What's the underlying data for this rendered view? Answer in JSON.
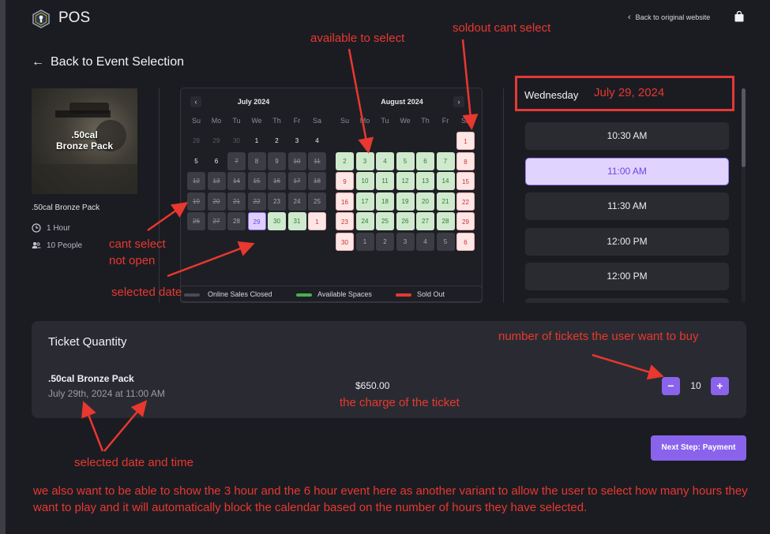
{
  "header": {
    "brand": "POS",
    "back_to_website": "Back to original website"
  },
  "nav": {
    "back_to_event": "Back to Event Selection"
  },
  "product": {
    "image_label": ".50cal\nBronze Pack",
    "name": ".50cal Bronze Pack",
    "duration": "1 Hour",
    "people": "10 People"
  },
  "calendar": {
    "weekdays": [
      "Su",
      "Mo",
      "Tu",
      "We",
      "Th",
      "Fr",
      "Sa"
    ],
    "months": [
      {
        "title": "July 2024",
        "days": [
          {
            "d": "28",
            "s": "faint"
          },
          {
            "d": "29",
            "s": "faint"
          },
          {
            "d": "30",
            "s": "faint"
          },
          {
            "d": "1",
            "s": "plain"
          },
          {
            "d": "2",
            "s": "plain"
          },
          {
            "d": "3",
            "s": "plain"
          },
          {
            "d": "4",
            "s": "plain"
          },
          {
            "d": "5",
            "s": "plain"
          },
          {
            "d": "6",
            "s": "plain"
          },
          {
            "d": "7",
            "s": "closed"
          },
          {
            "d": "8",
            "s": "blocked"
          },
          {
            "d": "9",
            "s": "blocked"
          },
          {
            "d": "10",
            "s": "closed"
          },
          {
            "d": "11",
            "s": "closed"
          },
          {
            "d": "12",
            "s": "closed"
          },
          {
            "d": "13",
            "s": "closed"
          },
          {
            "d": "14",
            "s": "closed"
          },
          {
            "d": "15",
            "s": "closed"
          },
          {
            "d": "16",
            "s": "closed"
          },
          {
            "d": "17",
            "s": "closed"
          },
          {
            "d": "18",
            "s": "closed"
          },
          {
            "d": "19",
            "s": "closed"
          },
          {
            "d": "20",
            "s": "closed"
          },
          {
            "d": "21",
            "s": "closed"
          },
          {
            "d": "22",
            "s": "closed"
          },
          {
            "d": "23",
            "s": "blocked"
          },
          {
            "d": "24",
            "s": "blocked"
          },
          {
            "d": "25",
            "s": "blocked"
          },
          {
            "d": "26",
            "s": "closed"
          },
          {
            "d": "27",
            "s": "closed"
          },
          {
            "d": "28",
            "s": "blocked"
          },
          {
            "d": "29",
            "s": "selected"
          },
          {
            "d": "30",
            "s": "avail"
          },
          {
            "d": "31",
            "s": "avail"
          },
          {
            "d": "1",
            "s": "sold"
          }
        ]
      },
      {
        "title": "August 2024",
        "days": [
          {
            "d": "",
            "s": "empty"
          },
          {
            "d": "",
            "s": "empty"
          },
          {
            "d": "",
            "s": "empty"
          },
          {
            "d": "",
            "s": "empty"
          },
          {
            "d": "",
            "s": "empty"
          },
          {
            "d": "",
            "s": "empty"
          },
          {
            "d": "1",
            "s": "sold"
          },
          {
            "d": "2",
            "s": "avail"
          },
          {
            "d": "3",
            "s": "avail"
          },
          {
            "d": "4",
            "s": "avail"
          },
          {
            "d": "5",
            "s": "avail"
          },
          {
            "d": "6",
            "s": "avail"
          },
          {
            "d": "7",
            "s": "avail"
          },
          {
            "d": "8",
            "s": "sold"
          },
          {
            "d": "9",
            "s": "sold"
          },
          {
            "d": "10",
            "s": "avail"
          },
          {
            "d": "11",
            "s": "avail"
          },
          {
            "d": "12",
            "s": "avail"
          },
          {
            "d": "13",
            "s": "avail"
          },
          {
            "d": "14",
            "s": "avail"
          },
          {
            "d": "15",
            "s": "sold"
          },
          {
            "d": "16",
            "s": "sold"
          },
          {
            "d": "17",
            "s": "avail"
          },
          {
            "d": "18",
            "s": "avail"
          },
          {
            "d": "19",
            "s": "avail"
          },
          {
            "d": "20",
            "s": "avail"
          },
          {
            "d": "21",
            "s": "avail"
          },
          {
            "d": "22",
            "s": "sold"
          },
          {
            "d": "23",
            "s": "sold"
          },
          {
            "d": "24",
            "s": "avail"
          },
          {
            "d": "25",
            "s": "avail"
          },
          {
            "d": "26",
            "s": "avail"
          },
          {
            "d": "27",
            "s": "avail"
          },
          {
            "d": "28",
            "s": "avail"
          },
          {
            "d": "29",
            "s": "sold"
          },
          {
            "d": "30",
            "s": "sold"
          },
          {
            "d": "1",
            "s": "blocked"
          },
          {
            "d": "2",
            "s": "blocked"
          },
          {
            "d": "3",
            "s": "blocked"
          },
          {
            "d": "4",
            "s": "blocked"
          },
          {
            "d": "5",
            "s": "blocked"
          },
          {
            "d": "6",
            "s": "sold"
          }
        ]
      }
    ],
    "legend": {
      "closed": "Online Sales Closed",
      "available": "Available Spaces",
      "sold": "Sold Out"
    },
    "colors": {
      "available": "#4caf50",
      "sold": "#e53935",
      "closed": "#4a4b53"
    }
  },
  "times": {
    "day_name": "Wednesday",
    "slots": [
      "10:30 AM",
      "11:00 AM",
      "11:30 AM",
      "12:00 PM",
      "12:00 PM"
    ],
    "selected_index": 1
  },
  "ticket": {
    "title": "Ticket Quantity",
    "name": ".50cal Bronze Pack",
    "datetime": "July 29th, 2024 at 11:00 AM",
    "price": "$650.00",
    "quantity": "10",
    "minus": "−",
    "plus": "+"
  },
  "next_step": "Next Step: Payment",
  "annotations": {
    "available": "available to select",
    "soldout": "soldout cant select",
    "date_box": "July 29, 2024",
    "cant_select": "cant select\nnot open",
    "selected_date": "selected date",
    "num_tickets": "number of tickets the user want to buy",
    "charge": "the charge of the ticket",
    "selected_datetime": "selected date and time",
    "footer_note": "we also want to be able to show the 3 hour and the 6 hour event here as another variant to allow the user to select how many hours they want to play and it will automatically block the calendar based on the number of hours they have selected.",
    "color": "#e8382f"
  }
}
